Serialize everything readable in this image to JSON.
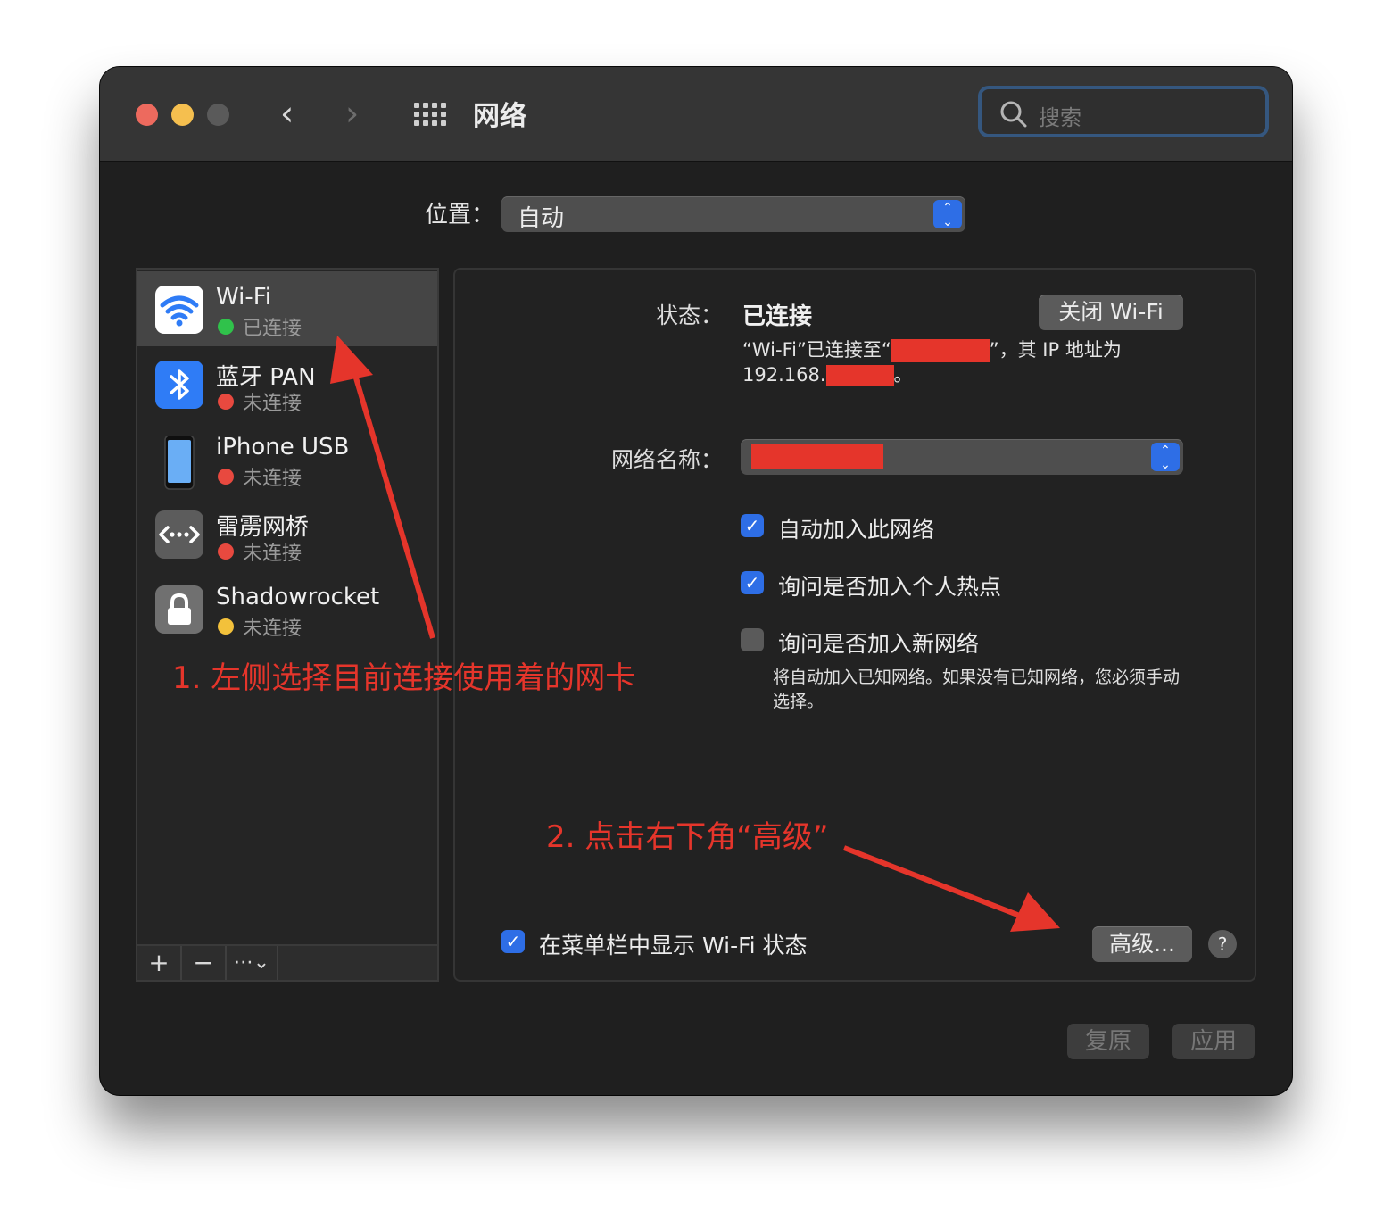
{
  "window": {
    "title": "网络"
  },
  "search": {
    "placeholder": "搜索"
  },
  "location": {
    "label": "位置：",
    "value": "自动"
  },
  "services": [
    {
      "name": "Wi-Fi",
      "status": "已连接",
      "status_color": "#30c24b"
    },
    {
      "name": "蓝牙 PAN",
      "status": "未连接",
      "status_color": "#e8493f"
    },
    {
      "name": "iPhone USB",
      "status": "未连接",
      "status_color": "#e8493f"
    },
    {
      "name": "雷雳网桥",
      "status": "未连接",
      "status_color": "#e8493f"
    },
    {
      "name": "Shadowrocket",
      "status": "未连接",
      "status_color": "#f3c13b"
    }
  ],
  "sidebar_footer": {
    "add": "+",
    "remove": "−",
    "more": "⋯"
  },
  "detail": {
    "status_label": "状态：",
    "status_value": "已连接",
    "turn_off_button": "关闭 Wi-Fi",
    "desc_part1": "“Wi-Fi”已连接至“",
    "desc_part2": "”，其 IP 地址为",
    "desc_ip_prefix": "192.168.",
    "desc_end": "。",
    "network_name_label": "网络名称：",
    "checkbox_auto_join": "自动加入此网络",
    "checkbox_ask_hotspot": "询问是否加入个人热点",
    "checkbox_ask_new": "询问是否加入新网络",
    "hint": "将自动加入已知网络。如果没有已知网络，您必须手动选择。",
    "checkbox_menubar": "在菜单栏中显示 Wi-Fi 状态",
    "advanced_button": "高级...",
    "help_button": "?"
  },
  "footer": {
    "revert": "复原",
    "apply": "应用"
  },
  "annotations": {
    "step1": "1. 左侧选择目前连接使用着的网卡",
    "step2": "2. 点击右下角“高级”"
  },
  "colors": {
    "annotation_red": "#e5352b",
    "accent_blue": "#2e6ee6"
  }
}
